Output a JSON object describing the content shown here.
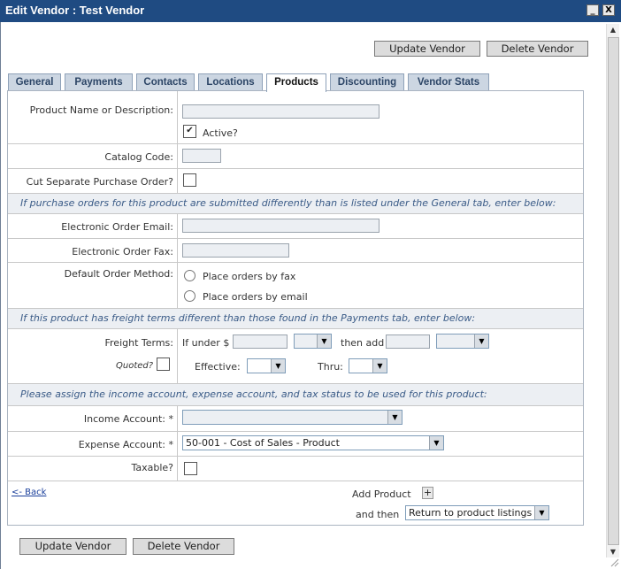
{
  "window": {
    "title": "Edit Vendor : Test Vendor",
    "minimize_glyph": "_",
    "close_glyph": "X"
  },
  "toolbar": {
    "update_label": "Update Vendor",
    "delete_label": "Delete Vendor"
  },
  "tabs": [
    {
      "label": "General"
    },
    {
      "label": "Payments"
    },
    {
      "label": "Contacts"
    },
    {
      "label": "Locations"
    },
    {
      "label": "Products",
      "active": true
    },
    {
      "label": "Discounting"
    },
    {
      "label": "Vendor Stats"
    }
  ],
  "form": {
    "product_name": {
      "label": "Product Name or Description:",
      "value": ""
    },
    "active": {
      "label": "Active?",
      "checked": true
    },
    "catalog_code": {
      "label": "Catalog Code:",
      "value": ""
    },
    "cut_po": {
      "label": "Cut Separate Purchase Order?",
      "checked": false
    },
    "band_orders": "If purchase orders for this product are submitted differently than is listed under the General tab, enter below:",
    "order_email": {
      "label": "Electronic Order Email:",
      "value": ""
    },
    "order_fax": {
      "label": "Electronic Order Fax:",
      "value": ""
    },
    "order_method": {
      "label": "Default Order Method:",
      "options": [
        "Place orders by fax",
        "Place orders by email"
      ]
    },
    "band_freight": "If this product has freight terms different than those found in the Payments tab, enter below:",
    "freight": {
      "label": "Freight Terms:",
      "if_under": "If under $",
      "then_add": "then add",
      "quoted": "Quoted?",
      "effective": "Effective:",
      "thru": "Thru:"
    },
    "band_accounts": "Please assign the income account, expense account, and tax status to be used for this product:",
    "income_account": {
      "label": "Income Account: *",
      "value": ""
    },
    "expense_account": {
      "label": "Expense Account: *",
      "value": "50-001 - Cost of Sales - Product"
    },
    "taxable": {
      "label": "Taxable?",
      "checked": false
    },
    "back_link": "<- Back",
    "add_product": "Add Product",
    "add_glyph": "+",
    "and_then": "and then",
    "and_then_value": "Return to product listings"
  },
  "glyphs": {
    "check": "✔",
    "dropdown": "▼",
    "scroll_up": "▲",
    "scroll_down": "▼"
  },
  "colors": {
    "titlebar": "#1f4b82",
    "tab": "#ccd6e2",
    "band_text": "#3a5b87",
    "band_bg": "#eceff3"
  }
}
